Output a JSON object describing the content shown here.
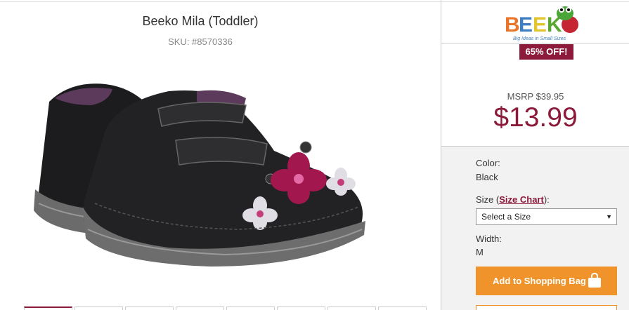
{
  "product": {
    "title": "Beeko Mila (Toddler)",
    "sku": "SKU: #8570336",
    "image_alt": "black-floral-toddler-boot"
  },
  "brand": {
    "logo_text": "BEEKO",
    "tagline": "Big Ideas in Small Sizes",
    "discount_badge": "65% OFF!"
  },
  "pricing": {
    "msrp": "MSRP $39.95",
    "price": "$13.99"
  },
  "options": {
    "color_label": "Color:",
    "color_value": "Black",
    "size_label_prefix": "Size (",
    "size_chart_link": "Size Chart",
    "size_label_suffix": "):",
    "size_select_value": "Select a Size",
    "width_label": "Width:",
    "width_value": "M"
  },
  "actions": {
    "add_to_bag": "Add to Shopping Bag"
  },
  "thumbnails": [
    {
      "id": 1,
      "active": true
    },
    {
      "id": 2,
      "active": false
    },
    {
      "id": 3,
      "active": false
    },
    {
      "id": 4,
      "active": false
    },
    {
      "id": 5,
      "active": false
    },
    {
      "id": 6,
      "active": false
    },
    {
      "id": 7,
      "active": false
    },
    {
      "id": 8,
      "active": false
    }
  ],
  "colors": {
    "accent": "#8b1a3b",
    "button": "#f0932b"
  }
}
